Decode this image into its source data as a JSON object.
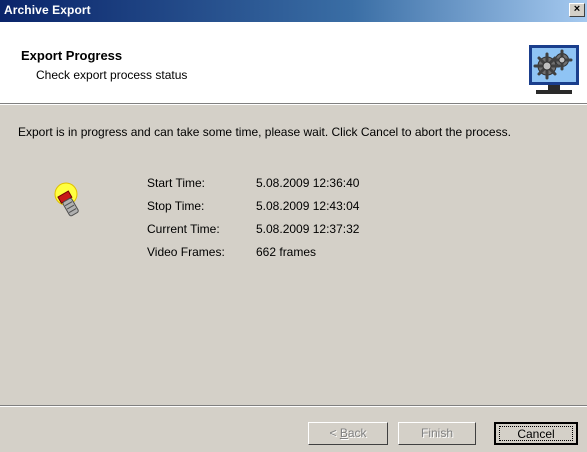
{
  "window": {
    "title": "Archive Export",
    "close_label": "×"
  },
  "header": {
    "title": "Export Progress",
    "subtitle": "Check export process status",
    "icon": "gears-monitor-icon"
  },
  "message": "Export is in progress and can take some time, please wait. Click Cancel to abort the process.",
  "status_icon": "flashlight-icon",
  "info": [
    {
      "label": "Start Time:",
      "value": "5.08.2009 12:36:40"
    },
    {
      "label": "Stop Time:",
      "value": "5.08.2009 12:43:04"
    },
    {
      "label": "Current Time:",
      "value": "5.08.2009 12:37:32"
    },
    {
      "label": "Video Frames:",
      "value": "662 frames"
    }
  ],
  "buttons": {
    "back": {
      "prefix": "< ",
      "mnemonic": "B",
      "rest": "ack",
      "enabled": false
    },
    "finish": {
      "label": "Finish",
      "enabled": false
    },
    "cancel": {
      "label": "Cancel",
      "enabled": true
    }
  },
  "colors": {
    "titlebar_start": "#0a246a",
    "titlebar_end": "#a6caf0",
    "face": "#d4d0c8"
  }
}
